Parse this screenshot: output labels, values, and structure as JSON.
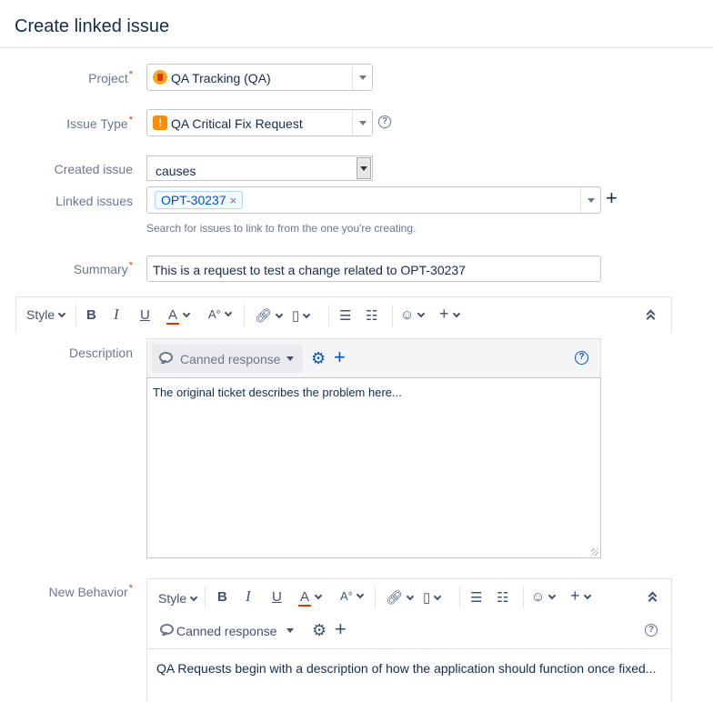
{
  "dialog": {
    "title": "Create linked issue"
  },
  "labels": {
    "project": "Project",
    "issue_type": "Issue Type",
    "created_issue": "Created issue",
    "linked_issues": "Linked issues",
    "summary": "Summary",
    "description": "Description",
    "new_behavior": "New Behavior",
    "required_mark": "*"
  },
  "fields": {
    "project": {
      "value": "QA Tracking (QA)",
      "icon": "project-icon"
    },
    "issue_type": {
      "value": "QA Critical Fix Request",
      "icon": "exclamation-icon"
    },
    "created_issue": {
      "value": "causes"
    },
    "linked_issues": {
      "chips": [
        "OPT-30237"
      ],
      "remove_glyph": "×",
      "help": "Search for issues to link to from the one you're creating."
    },
    "summary": {
      "value": "This is a request to test a change related to OPT-30237"
    },
    "description": {
      "value": "The original ticket describes the problem here..."
    },
    "new_behavior": {
      "value": "QA Requests begin with a description of how the application should function once fixed..."
    }
  },
  "toolbar": {
    "style": "Style",
    "bold": "B",
    "italic": "I",
    "underline": "U",
    "text_color": "A",
    "more_format": "A°",
    "text_color_accent": "#de350b"
  },
  "canned": {
    "label": "Canned response"
  },
  "colors": {
    "primary_text": "#172b4d",
    "label_text": "#6b778c",
    "link_blue": "#0052cc",
    "required_red": "#de350b",
    "issue_type_orange": "#ff8b00"
  }
}
